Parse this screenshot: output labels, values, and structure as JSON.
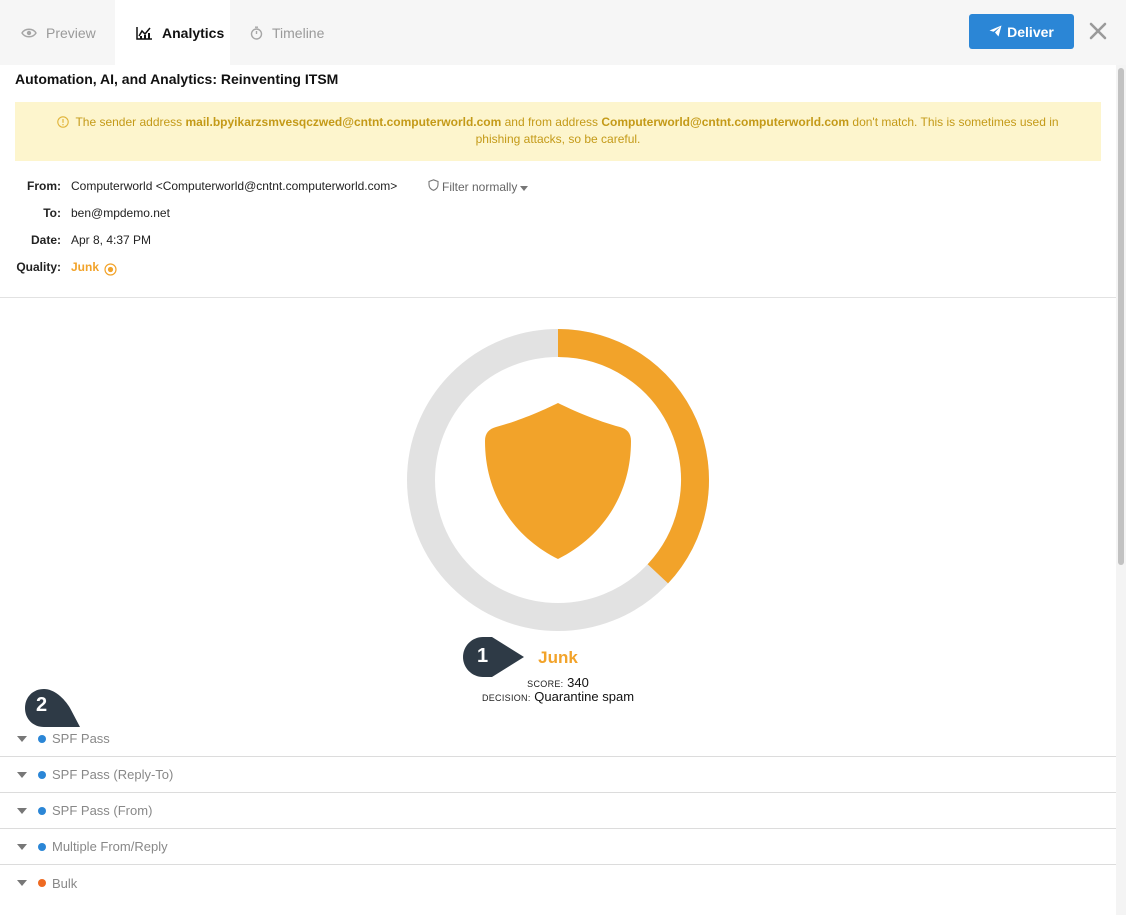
{
  "tabs": [
    {
      "label": "Preview",
      "icon": "eye-icon",
      "active": false
    },
    {
      "label": "Analytics",
      "icon": "analytics-chart-icon",
      "active": true
    },
    {
      "label": "Timeline",
      "icon": "stopwatch-icon",
      "active": false
    }
  ],
  "actions": {
    "deliver_label": "Deliver",
    "deliver_icon": "paper-plane-icon",
    "close_icon": "close-icon"
  },
  "email": {
    "subject": "Automation, AI, and Analytics: Reinventing ITSM",
    "warning": {
      "prefix": "The sender address ",
      "sender": "mail.bpyikarzsmvesqczwed@cntnt.computerworld.com",
      "middle": " and from address ",
      "from": "Computerworld@cntnt.computerworld.com",
      "suffix": " don't match. This is sometimes used in phishing attacks, so be careful."
    },
    "from_label": "From:",
    "from_value": "Computerworld <Computerworld@cntnt.computerworld.com>",
    "filter_label": "Filter normally",
    "to_label": "To:",
    "to_value": "ben@mpdemo.net",
    "date_label": "Date:",
    "date_value": "Apr 8, 4:37 PM",
    "quality_label": "Quality:",
    "quality_value": "Junk"
  },
  "analysis": {
    "verdict": "Junk",
    "score_label": "SCORE:",
    "score_value": "340",
    "decision_label": "DECISION:",
    "decision_value": "Quarantine spam",
    "gauge_fraction": 0.37
  },
  "callouts": [
    {
      "label": "1"
    },
    {
      "label": "2"
    }
  ],
  "rules": [
    {
      "label": "SPF Pass",
      "status": "info"
    },
    {
      "label": "SPF Pass (Reply-To)",
      "status": "info"
    },
    {
      "label": "SPF Pass (From)",
      "status": "info"
    },
    {
      "label": "Multiple From/Reply",
      "status": "info"
    },
    {
      "label": "Bulk",
      "status": "warning"
    }
  ],
  "colors": {
    "accent": "#2b86d6",
    "junk": "#f2a32a",
    "warning_bg": "#fdf5cd",
    "warning_text": "#c49a18",
    "status_info": "#2b86d6",
    "status_warning": "#ee6a22",
    "gauge_track": "#e2e2e2",
    "callout": "#2e3a46"
  }
}
